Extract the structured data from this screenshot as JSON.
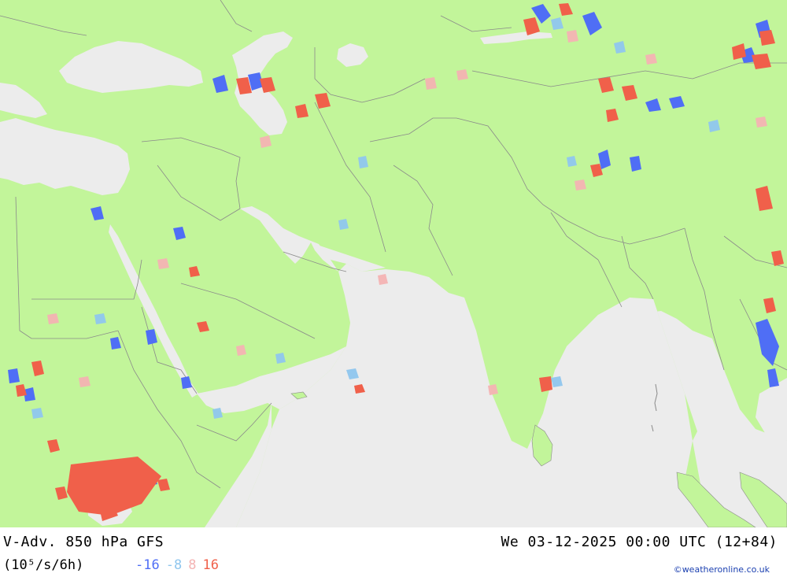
{
  "map": {
    "colors": {
      "land": "#c2f59a",
      "sea": "#ececec",
      "border": "#8a8a8a",
      "neg_strong": "#4f6ef5",
      "neg_weak": "#8fc6ee",
      "pos_weak": "#f4b3b3",
      "pos_strong": "#f0604a"
    }
  },
  "footer": {
    "title_left": "V-Adv. 850 hPa  GFS",
    "title_right": "We 03-12-2025 00:00 UTC (12+84)",
    "units": "(10⁵/s/6h)",
    "legend": [
      {
        "label": "-16",
        "color": "#4f6ef5"
      },
      {
        "label": "-8",
        "color": "#8fc6ee"
      },
      {
        "label": "8",
        "color": "#f4b3b3"
      },
      {
        "label": "16",
        "color": "#f0604a"
      }
    ],
    "credit": "©weatheronline.co.uk"
  }
}
